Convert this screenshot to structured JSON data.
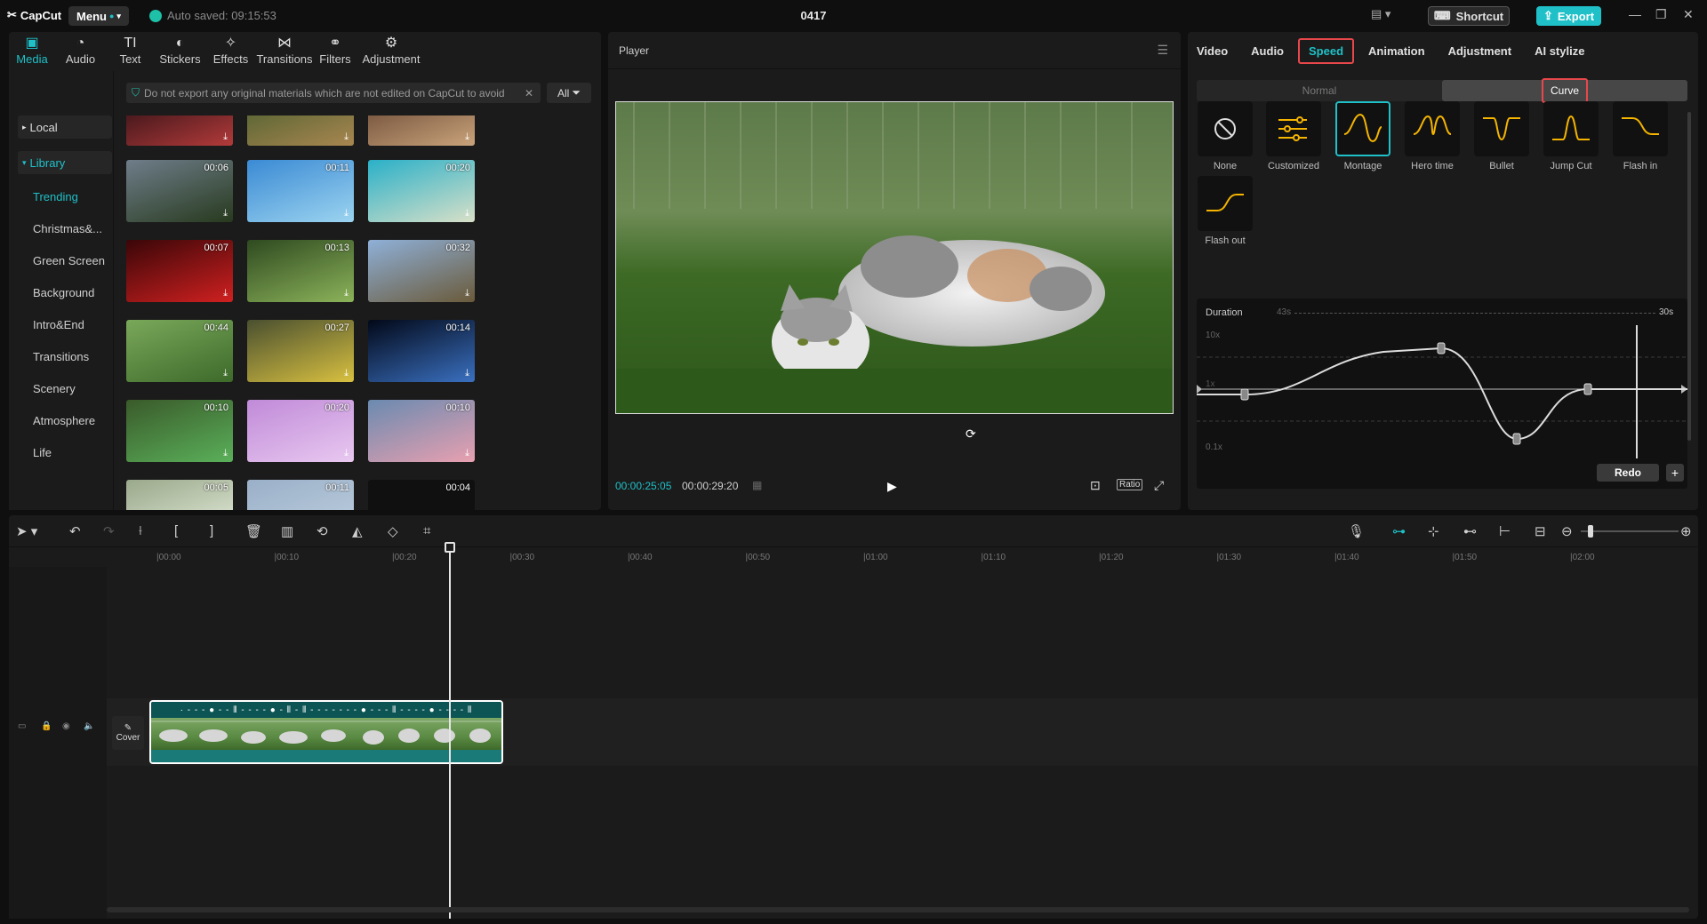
{
  "app": {
    "logo": "CapCut",
    "menu_label": "Menu",
    "autosave": "Auto saved: 09:15:53",
    "project_title": "0417",
    "shortcut_label": "Shortcut",
    "export_label": "Export"
  },
  "media_tabs": [
    {
      "label": "Media",
      "icon": "media-icon"
    },
    {
      "label": "Audio",
      "icon": "audio-icon"
    },
    {
      "label": "Text",
      "icon": "text-icon"
    },
    {
      "label": "Stickers",
      "icon": "sticker-icon"
    },
    {
      "label": "Effects",
      "icon": "effects-icon"
    },
    {
      "label": "Transitions",
      "icon": "transitions-icon"
    },
    {
      "label": "Filters",
      "icon": "filters-icon"
    },
    {
      "label": "Adjustment",
      "icon": "adjustment-icon"
    }
  ],
  "sidebar": {
    "local": "Local",
    "library": "Library",
    "items": [
      "Trending",
      "Christmas&...",
      "Green Screen",
      "Background",
      "Intro&End",
      "Transitions",
      "Scenery",
      "Atmosphere",
      "Life"
    ]
  },
  "notice": "Do not export any original materials which are not edited on CapCut to avoid",
  "filter_label": "All",
  "thumb_durations": [
    "",
    "",
    "",
    "00:06",
    "00:11",
    "00:20",
    "00:07",
    "00:13",
    "00:32",
    "00:44",
    "00:27",
    "00:14",
    "00:10",
    "00:20",
    "00:10",
    "00:05",
    "00:11",
    "00:04"
  ],
  "player": {
    "title": "Player",
    "current_time": "00:00:25:05",
    "total_time": "00:00:29:20",
    "ratio_label": "Ratio"
  },
  "right_tabs": [
    "Video",
    "Audio",
    "Speed",
    "Animation",
    "Adjustment",
    "AI stylize"
  ],
  "speed": {
    "normal_label": "Normal",
    "curve_label": "Curve",
    "presets": [
      "None",
      "Customized",
      "Montage",
      "Hero time",
      "Bullet",
      "Jump Cut",
      "Flash in",
      "Flash out"
    ],
    "selected_preset": "Montage",
    "duration_label": "Duration",
    "duration_from": "43s",
    "duration_to": "30s",
    "y_top": "10x",
    "y_mid": "1x",
    "y_bottom": "0.1x",
    "redo_label": "Redo",
    "accent_color": "#f4b400"
  },
  "timeline": {
    "ruler_labels": [
      "00:00",
      "00:10",
      "00:20",
      "00:30",
      "00:40",
      "00:50",
      "01:00",
      "01:10",
      "01:20",
      "01:30",
      "01:40",
      "01:50",
      "02:00"
    ],
    "cover_label": "Cover"
  }
}
